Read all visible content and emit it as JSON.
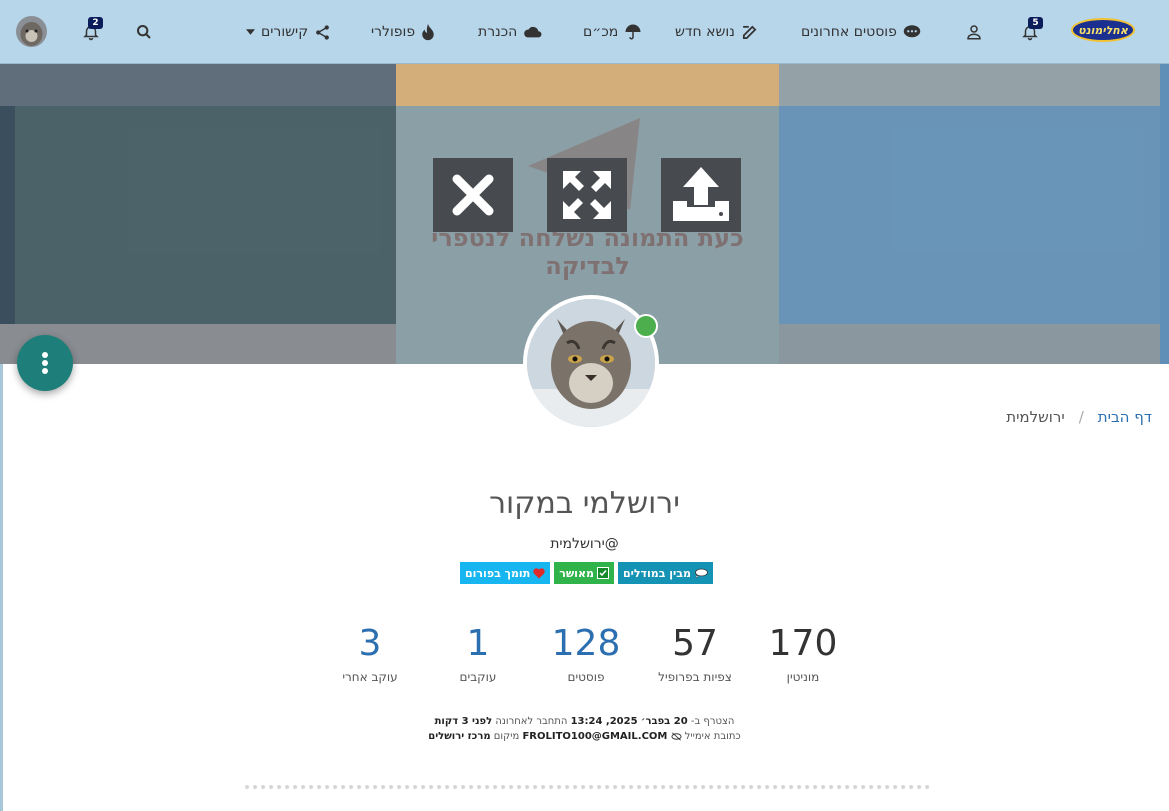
{
  "navbar": {
    "logo_text": "אחלימונט",
    "notifications_count": "5",
    "recent_posts": "פוסטים אחרונים",
    "new_topic": "נושא חדש",
    "category_1": "מכ״ם",
    "category_2": "הכנרת",
    "popular": "פופולרי",
    "links": "קישורים",
    "chats_count": "2"
  },
  "cover": {
    "text": "כעת התמונה נשלחה לנטפרי לבדיקה"
  },
  "breadcrumb": {
    "home": "דף הבית",
    "separator": "/",
    "current": "ירושלמית"
  },
  "profile": {
    "fullname": "ירושלמי במקור",
    "username": "@ירושלמית",
    "badges": [
      {
        "label": "מבין במודלים",
        "color": "#1593b5"
      },
      {
        "label": "מאושר",
        "color": "#2fb34a"
      },
      {
        "label": "תומך בפורום",
        "color": "#18b6f0"
      }
    ]
  },
  "stats": [
    {
      "value": "170",
      "label": "מוניטין"
    },
    {
      "value": "57",
      "label": "צפיות בפרופיל"
    },
    {
      "value": "128",
      "label": "פוסטים"
    },
    {
      "value": "1",
      "label": "עוקבים"
    },
    {
      "value": "3",
      "label": "עוקב אחרי"
    }
  ],
  "meta": {
    "joined_label": "הצטרף ב-",
    "joined_value": "20 בפבר׳ 2025, 13:24",
    "last_online_label": "התחבר לאחרונה",
    "last_online_value": "לפני 3 דקות",
    "email_label": "כתובת אימייל",
    "email_value": "FROLITO100@GMAIL.COM",
    "location_label": "מיקום",
    "location_value": "מרכז ירושלים"
  },
  "colors": {
    "navbar_bg": "#b7d6ea",
    "link_blue": "#2c6fb0",
    "fab": "#1e7f7a",
    "online": "#4cae4c"
  }
}
